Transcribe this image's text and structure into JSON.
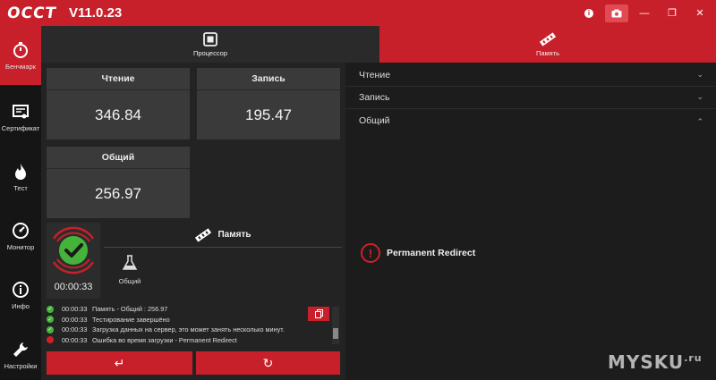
{
  "app": {
    "logo": "OCCT",
    "version": "V11.0.23"
  },
  "titlebar": {
    "buttons": [
      "info-icon",
      "camera-icon",
      "minimize-icon",
      "maximize-icon",
      "close-icon"
    ],
    "minimize": "—",
    "maximize": "❐",
    "close": "✕",
    "info": "i"
  },
  "sidebar": {
    "items": [
      {
        "label": "Бенчмарк",
        "icon": "stopwatch-icon",
        "active": true
      },
      {
        "label": "Сертификат",
        "icon": "certificate-icon",
        "active": false
      },
      {
        "label": "Тест",
        "icon": "flame-icon",
        "active": false
      },
      {
        "label": "Монитор",
        "icon": "gauge-icon",
        "active": false
      },
      {
        "label": "Инфо",
        "icon": "info-icon",
        "active": false
      },
      {
        "label": "Настройки",
        "icon": "wrench-icon",
        "active": false
      }
    ]
  },
  "tabs": {
    "cpu": "Процессор",
    "memory": "Память"
  },
  "results": {
    "read": {
      "label": "Чтение",
      "value": "346.84"
    },
    "write": {
      "label": "Запись",
      "value": "195.47"
    },
    "total": {
      "label": "Общий",
      "value": "256.97"
    }
  },
  "status": {
    "timer": "00:00:33",
    "memory_title": "Память",
    "sub_label": "Общий"
  },
  "log": [
    {
      "status": "ok",
      "time": "00:00:33",
      "text": "Память - Общий : 256.97"
    },
    {
      "status": "ok",
      "time": "00:00:33",
      "text": "Тестирование завершёно"
    },
    {
      "status": "ok",
      "time": "00:00:33",
      "text": "Загрузка данных на сервер, это может занять несколько минут."
    },
    {
      "status": "err",
      "time": "00:00:33",
      "text": "Ошибка во время загрузки - Permanent Redirect"
    }
  ],
  "actions": {
    "back": "↵",
    "restart": "↻"
  },
  "right": {
    "sections": [
      {
        "label": "Чтение",
        "chevron": "⌄"
      },
      {
        "label": "Запись",
        "chevron": "⌄"
      },
      {
        "label": "Общий",
        "chevron": "⌃"
      }
    ],
    "error_text": "Permanent Redirect",
    "error_mark": "!"
  },
  "watermark": {
    "text": "MYSKU",
    "suffix": ".ru"
  },
  "colors": {
    "accent": "#c8202a",
    "ok": "#45b33a",
    "bg": "#1e1e1e"
  }
}
